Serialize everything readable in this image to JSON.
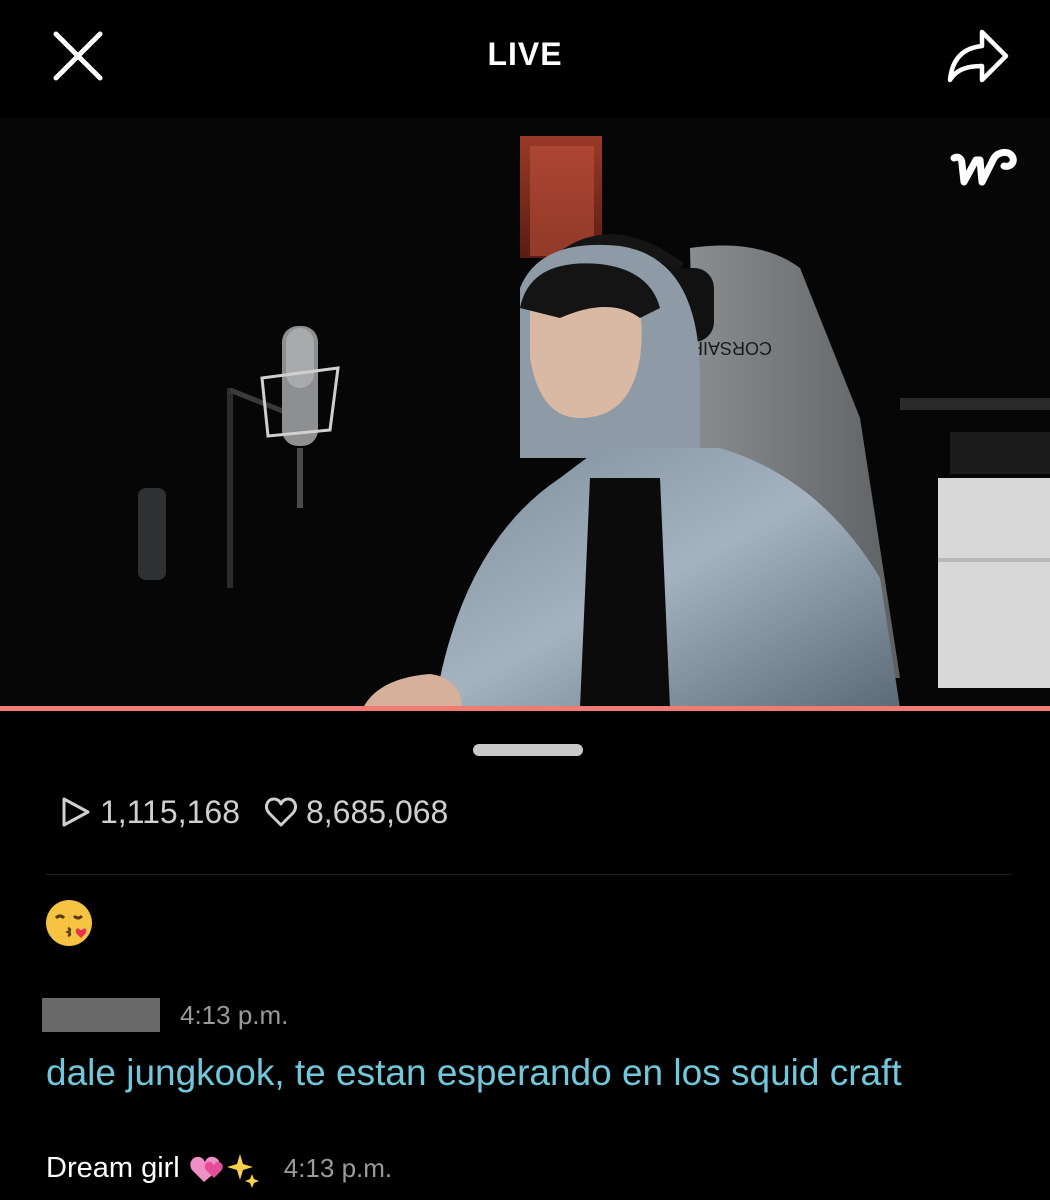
{
  "header": {
    "title": "LIVE",
    "close_icon": "close-icon",
    "share_icon": "share-icon"
  },
  "player": {
    "logo_icon": "weverse-logo-icon",
    "chair_brand": "CORSAIR",
    "progress_color": "#f07b72"
  },
  "stats": {
    "views": "1,115,168",
    "likes": "8,685,068",
    "views_icon": "play-icon",
    "likes_icon": "heart-icon"
  },
  "chat": {
    "messages": [
      {
        "emoji": "kissing-face-icon"
      },
      {
        "user_redacted": true,
        "time": "4:13 p.m.",
        "text": "dale jungkook, te estan esperando en los squid craft",
        "text_color": "#72c7db"
      },
      {
        "user": "Dream girl",
        "user_emoji": "hearts-sparkles-icon",
        "time": "4:13 p.m."
      }
    ]
  }
}
